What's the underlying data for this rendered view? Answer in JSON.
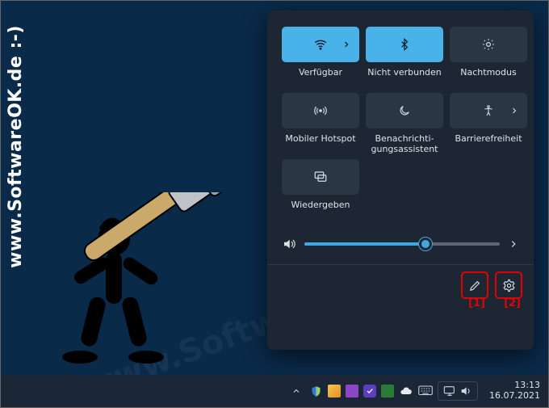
{
  "watermark": {
    "side": "www.SoftwareOK.de :-)",
    "faint": "www.SoftwareOK.de :-)"
  },
  "panel": {
    "tiles": [
      {
        "key": "wifi",
        "label": "Verfügbar",
        "icon": "wifi-icon",
        "active": true,
        "expand": true
      },
      {
        "key": "bluetooth",
        "label": "Nicht verbunden",
        "icon": "bluetooth-icon",
        "active": true
      },
      {
        "key": "night",
        "label": "Nachtmodus",
        "icon": "nightlight-icon"
      },
      {
        "key": "hotspot",
        "label": "Mobiler Hotspot",
        "icon": "hotspot-icon"
      },
      {
        "key": "focus",
        "label": "Benachrichti­gungsassistent",
        "icon": "moon-icon"
      },
      {
        "key": "access",
        "label": "Barrierefreiheit",
        "icon": "accessibility-icon",
        "expand": true
      },
      {
        "key": "cast",
        "label": "Wiedergeben",
        "icon": "cast-icon"
      }
    ],
    "volume": {
      "percent": 62
    },
    "footer": {
      "edit": "Bearbeiten",
      "settings": "Einstellungen"
    }
  },
  "annotations": {
    "one": "[1]",
    "two": "[2]"
  },
  "taskbar": {
    "time": "13:13",
    "date": "16.07.2021"
  }
}
